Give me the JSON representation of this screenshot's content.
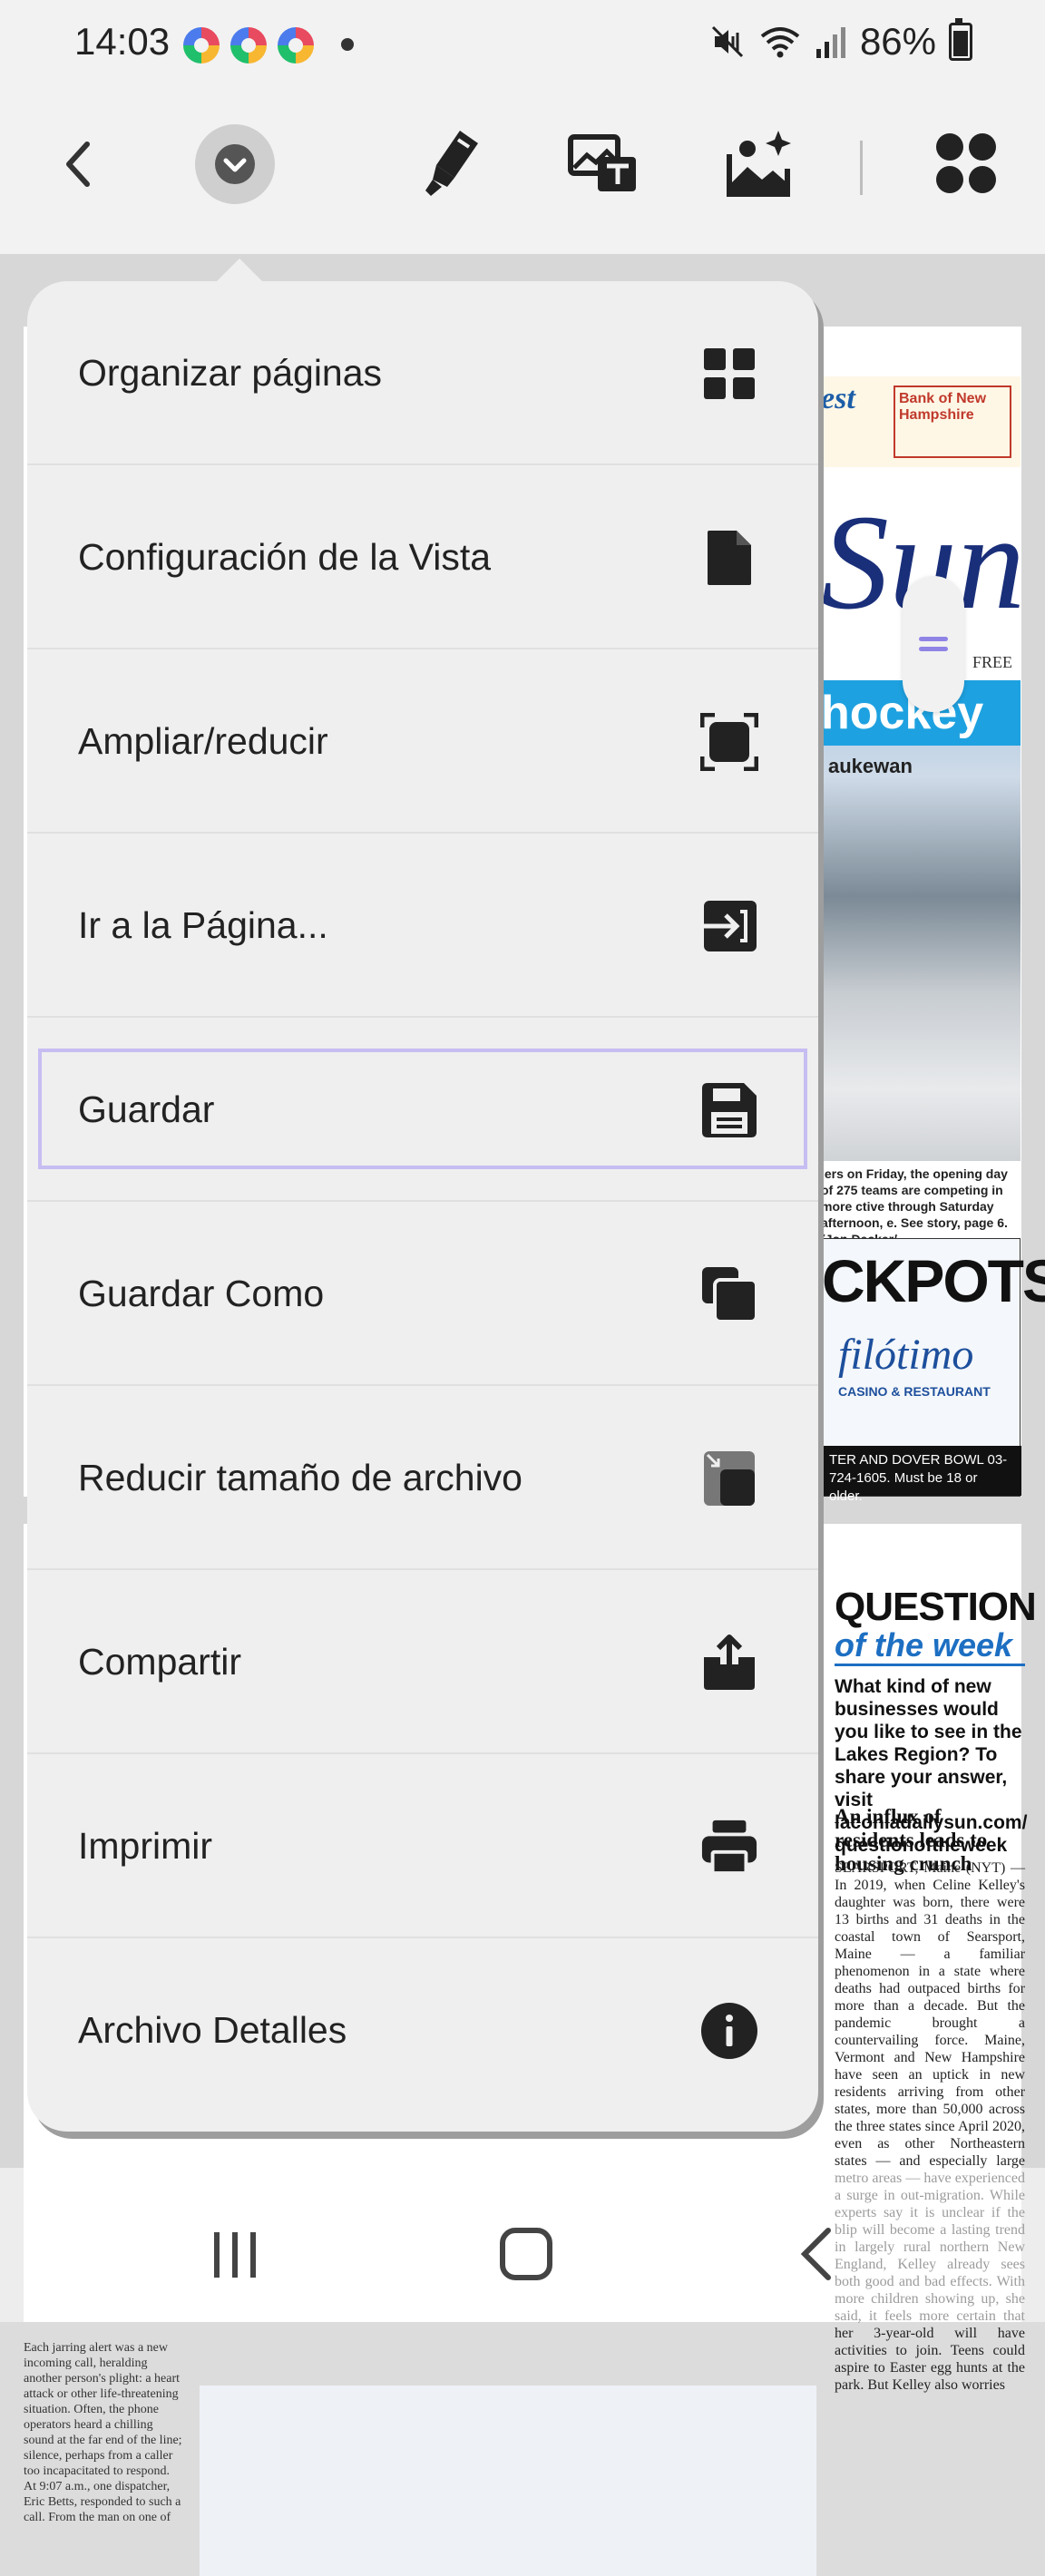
{
  "status_bar": {
    "time": "14:03",
    "battery": "86%"
  },
  "toolbar": {
    "icons": [
      "back-arrow-icon",
      "chevron-down-icon",
      "highlighter-icon",
      "text-on-image-icon",
      "image-edit-icon",
      "apps-grid-icon"
    ]
  },
  "menu": {
    "items": [
      {
        "label": "Organizar páginas",
        "icon": "grid-icon"
      },
      {
        "label": "Configuración de la Vista",
        "icon": "document-icon"
      },
      {
        "label": "Ampliar/reducir",
        "icon": "fit-screen-icon"
      },
      {
        "label": "Ir a la Página...",
        "icon": "go-to-page-icon"
      },
      {
        "label": "Guardar",
        "icon": "save-icon",
        "selected": true
      },
      {
        "label": "Guardar Como",
        "icon": "copy-icon"
      },
      {
        "label": "Reducir tamaño de archivo",
        "icon": "reduce-size-icon"
      },
      {
        "label": "Compartir",
        "icon": "share-icon"
      },
      {
        "label": "Imprimir",
        "icon": "print-icon"
      },
      {
        "label": "Archivo Detalles",
        "icon": "info-icon"
      }
    ],
    "selected_border_color": "#c7bdf2"
  },
  "document": {
    "ad_best": "est",
    "ad_bank": "Bank of New Hampshire",
    "masthead": "Sun",
    "masthead_free": "FREE",
    "photo_headline": "hockey",
    "photo_sub": "aukewan",
    "caption": "lers on Friday, the opening day of 275 teams are competing in more ctive through Saturday afternoon, e. See story, page 6. (Jon Decker/",
    "casino_top": "CKPOTS",
    "casino_brand": "filótimo",
    "casino_sub": "CASINO & RESTAURANT",
    "casino_foot": "TER AND DOVER BOWL 03-724-1605. Must be 18 or older.",
    "qotw_title": "QUESTION",
    "qotw_sub": "of the week",
    "qotw_text": "What kind of new businesses would you like to see in the Lakes Region? To share your answer, visit laconiadailysun.com/ questionoftheweek",
    "news_head": "An influx of residents leads to housing crunch",
    "news_body": "SEARSPORT, Maine (NYT) — In 2019, when Celine Kelley's daughter was born, there were 13 births and 31 deaths in the coastal town of Searsport, Maine — a familiar phenomenon in a state where deaths had outpaced births for more than a decade. But the pandemic brought a countervailing force. Maine, Vermont and New Hampshire have seen an uptick in new residents arriving from other states, more than 50,000 across the three states since April 2020, even as other Northeastern states — and especially large metro areas — have experienced a surge in out-migration. While experts say it is unclear if the blip will become a lasting trend in largely rural northern New England, Kelley already sees both good and bad effects. With more children showing up, she said, it feels more certain that her 3-year-old will have activities to join. Teens could aspire to Easter egg hunts at the park. But Kelley also worries",
    "left_strip": "Each jarring alert was a new incoming call, heralding another person's plight: a heart attack or other life-threatening situation. Often, the phone operators heard a chilling sound at the far end of the line; silence, perhaps from a caller too incapacitated to respond. At 9:07 a.m., one dispatcher, Eric Betts, responded to such a call. From the man on one of"
  },
  "colors": {
    "menu_bg": "#efefef",
    "accent_handle": "#8f84e6"
  }
}
